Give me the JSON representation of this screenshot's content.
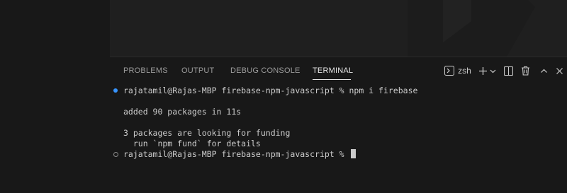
{
  "panel": {
    "tabs": [
      {
        "label": "PROBLEMS"
      },
      {
        "label": "OUTPUT"
      },
      {
        "label": "DEBUG CONSOLE"
      },
      {
        "label": "TERMINAL"
      }
    ],
    "active_tab": "TERMINAL",
    "shell": "zsh",
    "icons": {
      "terminal": "terminal-icon",
      "new": "plus-icon",
      "dropdown": "chevron-down-icon",
      "split": "split-terminal-icon",
      "trash": "trash-icon",
      "maximize": "chevron-up-icon",
      "close": "close-icon"
    }
  },
  "terminal": {
    "lines": [
      "rajatamil@Rajas-MBP firebase-npm-javascript % npm i firebase",
      "",
      "added 90 packages in 11s",
      "",
      "3 packages are looking for funding",
      "  run `npm fund` for details",
      "rajatamil@Rajas-MBP firebase-npm-javascript % "
    ]
  },
  "colors": {
    "accent": "#3794ff",
    "background": "#181818",
    "text": "#cccccc"
  }
}
